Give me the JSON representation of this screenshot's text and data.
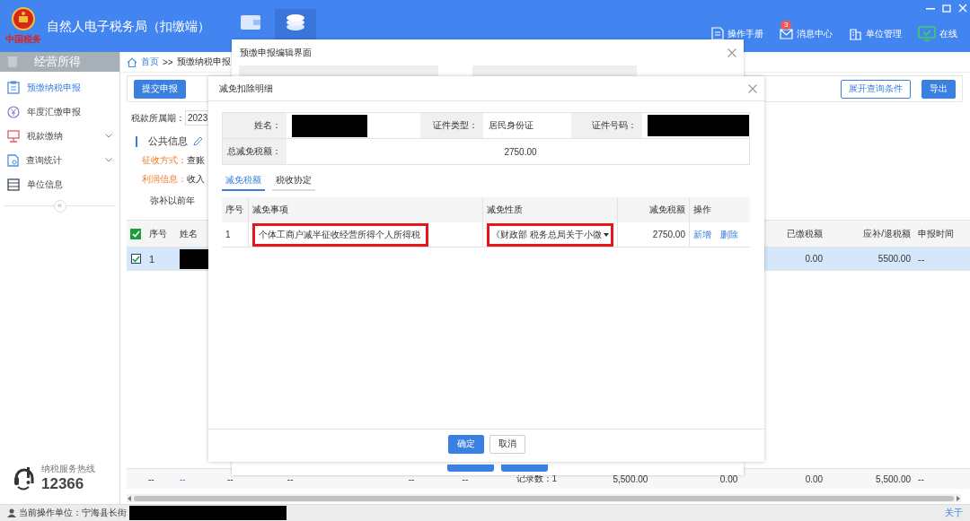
{
  "app": {
    "title": "自然人电子税务局（扣缴端）",
    "logo_text": "中国税务"
  },
  "nav_tabs": [
    {
      "selected": false
    },
    {
      "selected": true
    }
  ],
  "toolbar": [
    {
      "kind": "manual",
      "label": "操作手册"
    },
    {
      "kind": "message",
      "label": "消息中心",
      "badge": "3"
    },
    {
      "kind": "unit",
      "label": "单位管理"
    },
    {
      "kind": "online",
      "label": "在线"
    }
  ],
  "sidebar": {
    "title": "经营所得",
    "items": [
      {
        "kind": "link",
        "label": "预缴纳税申报",
        "selected": true
      },
      {
        "kind": "link",
        "label": "年度汇缴申报",
        "selected": false
      },
      {
        "kind": "group",
        "label": "税款缴纳",
        "selected": false
      },
      {
        "kind": "group",
        "label": "查询统计",
        "selected": false
      },
      {
        "kind": "link",
        "label": "单位信息",
        "selected": false
      }
    ],
    "collapse": "«",
    "hotline": {
      "label": "纳税服务热线",
      "number": "12366"
    }
  },
  "breadcrumb": {
    "items": [
      "首页",
      "预缴纳税申报"
    ],
    "separator": ">>"
  },
  "actions": {
    "left": [
      {
        "label": "提交申报",
        "kind": "primary"
      }
    ],
    "right": [
      {
        "label": "展开查询条件",
        "kind": "default"
      },
      {
        "label": "导出",
        "kind": "primary"
      }
    ]
  },
  "form": {
    "period_label": "税款所属期：",
    "period_value": "2023",
    "section": "公共信息",
    "lines": [
      {
        "label": "征收方式：",
        "value": "查账"
      },
      {
        "label": "利润信息：",
        "value": "收入"
      }
    ],
    "note": "弥补以前年"
  },
  "table": {
    "all_checked": true,
    "columns": [
      {
        "label": "序号"
      },
      {
        "label": "姓名"
      },
      {
        "label": "已缴税额"
      },
      {
        "label": "应补/退税额"
      },
      {
        "label": "申报时间"
      }
    ],
    "rows": [
      {
        "checked": true,
        "selected": true,
        "no": "1",
        "name_redacted": true,
        "paid": "0.00",
        "due": "5500.00",
        "time": "--"
      }
    ],
    "summary": [
      {
        "text": "--",
        "kind": "plain"
      },
      {
        "text": "--",
        "kind": "link"
      },
      {
        "text": "--",
        "kind": "plain"
      },
      {
        "text": "--",
        "kind": "plain"
      },
      {
        "text": "--",
        "kind": "plain"
      },
      {
        "text": "--",
        "kind": "plain"
      },
      {
        "text": "记录数：1",
        "kind": "plain"
      },
      {
        "text": "5,500.00",
        "kind": "number"
      },
      {
        "text": "0.00",
        "kind": "number"
      },
      {
        "text": "0.00",
        "kind": "number"
      },
      {
        "text": "5,500.00",
        "kind": "number"
      },
      {
        "text": "--",
        "kind": "plain"
      }
    ]
  },
  "outer_dialog": {
    "title": "预缴申报编辑界面"
  },
  "dialog": {
    "title": "减免扣除明细",
    "info": {
      "name_label": "姓名：",
      "name_redacted": true,
      "id_type_label": "证件类型：",
      "id_type": "居民身份证",
      "id_no_label": "证件号码：",
      "id_no_redacted": true,
      "total_label": "总减免税额：",
      "total": "2750.00"
    },
    "tabs": [
      {
        "label": "减免税额",
        "selected": true
      },
      {
        "label": "税收协定",
        "selected": false
      }
    ],
    "columns": [
      {
        "label": "序号"
      },
      {
        "label": "减免事项"
      },
      {
        "label": "减免性质"
      },
      {
        "label": "减免税额"
      },
      {
        "label": "操作"
      }
    ],
    "rows": [
      {
        "no": "1",
        "item": "个体工商户减半征收经营所得个人所得税",
        "item_highlighted": true,
        "nature": "《财政部 税务总局关于小微",
        "nature_highlighted": true,
        "amount": "2750.00",
        "actions": [
          "新增",
          "删除"
        ]
      }
    ],
    "buttons": [
      {
        "label": "确定",
        "kind": "primary"
      },
      {
        "label": "取消",
        "kind": "default"
      }
    ]
  },
  "status_bar": {
    "unit_label": "当前操作单位：宁海县长街",
    "unit_redacted": true,
    "link": "关于"
  }
}
